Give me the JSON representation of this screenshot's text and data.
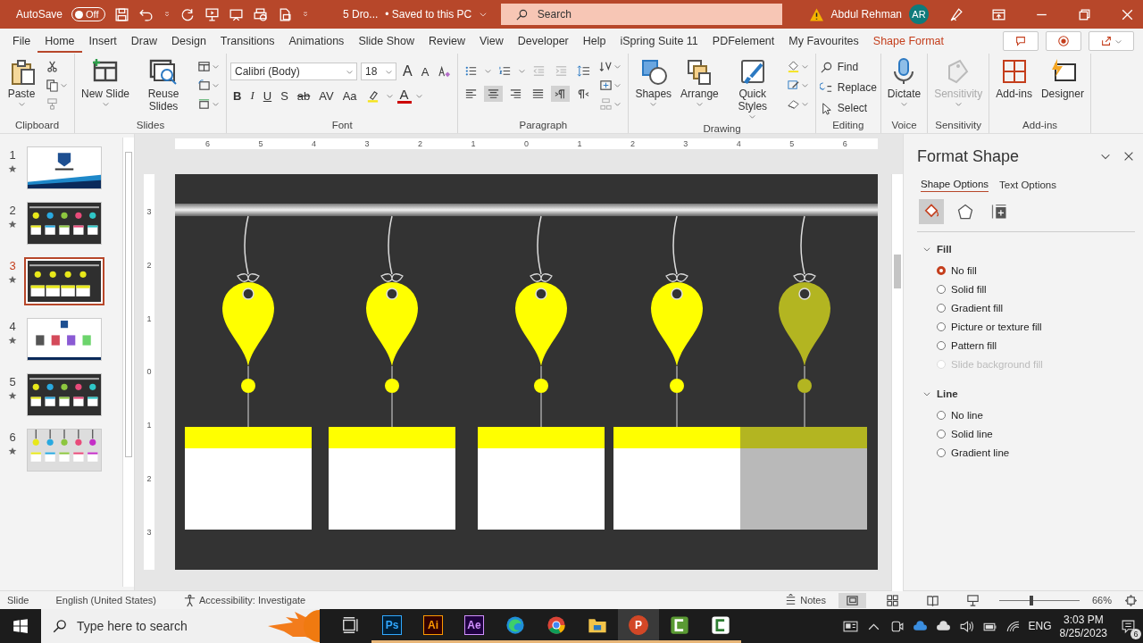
{
  "title_bar": {
    "autosave_label": "AutoSave",
    "autosave_toggle": {
      "label": "Off",
      "on": false
    },
    "document_title": "5 Dro...",
    "save_status": "• Saved to this PC",
    "search": {
      "placeholder": "Search"
    },
    "user_name": "Abdul Rehman",
    "avatar_initials": "AR"
  },
  "menu_tabs": [
    {
      "label": "File",
      "selected": false,
      "kind": "normal"
    },
    {
      "label": "Home",
      "selected": true,
      "kind": "normal"
    },
    {
      "label": "Insert",
      "selected": false,
      "kind": "normal"
    },
    {
      "label": "Draw",
      "selected": false,
      "kind": "normal"
    },
    {
      "label": "Design",
      "selected": false,
      "kind": "normal"
    },
    {
      "label": "Transitions",
      "selected": false,
      "kind": "normal"
    },
    {
      "label": "Animations",
      "selected": false,
      "kind": "normal"
    },
    {
      "label": "Slide Show",
      "selected": false,
      "kind": "normal"
    },
    {
      "label": "Review",
      "selected": false,
      "kind": "normal"
    },
    {
      "label": "View",
      "selected": false,
      "kind": "normal"
    },
    {
      "label": "Developer",
      "selected": false,
      "kind": "normal"
    },
    {
      "label": "Help",
      "selected": false,
      "kind": "normal"
    },
    {
      "label": "iSpring Suite 11",
      "selected": false,
      "kind": "normal"
    },
    {
      "label": "PDFelement",
      "selected": false,
      "kind": "normal"
    },
    {
      "label": "My Favourites",
      "selected": false,
      "kind": "normal"
    },
    {
      "label": "Shape Format",
      "selected": false,
      "kind": "contextual"
    }
  ],
  "ribbon": {
    "groups": [
      {
        "label": "Clipboard",
        "kind": "clipboard",
        "large": [
          {
            "label": "Paste",
            "disabled": false
          }
        ]
      },
      {
        "label": "Slides",
        "kind": "slides",
        "large": [
          {
            "label": "New Slide",
            "disabled": false
          },
          {
            "label": "Reuse Slides",
            "disabled": false
          }
        ]
      },
      {
        "label": "Font",
        "kind": "font",
        "font_name": "Calibri (Body)",
        "font_size": "18",
        "row1": [
          "A",
          "A"
        ],
        "row2": [
          "B",
          "I",
          "U",
          "S",
          "ab",
          "AV",
          "Aa"
        ],
        "font_color_label": "A"
      },
      {
        "label": "Paragraph",
        "kind": "paragraph",
        "row1": [
          {
            "kind": "bullets",
            "selected": false
          },
          {
            "kind": "numbering",
            "selected": false
          },
          {
            "kind": "outdent",
            "selected": false
          },
          {
            "kind": "indent",
            "selected": false
          },
          {
            "kind": "line-spacing",
            "selected": false
          }
        ],
        "row2": [
          {
            "kind": "align-left",
            "selected": false
          },
          {
            "kind": "align-center",
            "selected": true
          },
          {
            "kind": "align-right",
            "selected": false
          },
          {
            "kind": "justify",
            "selected": false
          },
          {
            "kind": "ltr",
            "selected": true
          },
          {
            "kind": "rtl",
            "selected": false
          }
        ]
      },
      {
        "label": "Drawing",
        "kind": "drawing",
        "large": [
          {
            "label": "Shapes",
            "disabled": false
          },
          {
            "label": "Arrange",
            "disabled": false
          },
          {
            "label": "Quick Styles",
            "disabled": false
          }
        ]
      },
      {
        "label": "Editing",
        "kind": "editing",
        "small_buttons": [
          "Find",
          "Replace",
          "Select"
        ]
      },
      {
        "label": "Voice",
        "kind": "voice",
        "large": [
          {
            "label": "Dictate",
            "disabled": false
          }
        ]
      },
      {
        "label": "Sensitivity",
        "kind": "sensitivity",
        "large": [
          {
            "label": "Sensitivity",
            "disabled": true
          }
        ]
      },
      {
        "label": "Add-ins",
        "kind": "addins",
        "large": [
          {
            "label": "Add-ins",
            "disabled": false
          },
          {
            "label": "Designer",
            "disabled": false
          }
        ]
      }
    ]
  },
  "thumbnails": [
    {
      "number": "1",
      "kind": "title",
      "selected": false
    },
    {
      "number": "2",
      "kind": "tags-dark",
      "selected": false
    },
    {
      "number": "3",
      "kind": "tags-yellow",
      "selected": true
    },
    {
      "number": "4",
      "kind": "infographic",
      "selected": false
    },
    {
      "number": "5",
      "kind": "tags-dark",
      "selected": false
    },
    {
      "number": "6",
      "kind": "tags-light",
      "selected": false
    }
  ],
  "rulers": {
    "horizontal": [
      "6",
      "5",
      "4",
      "3",
      "2",
      "1",
      "0",
      "1",
      "2",
      "3",
      "4",
      "5",
      "6"
    ],
    "vertical": [
      "3",
      "2",
      "1",
      "0",
      "1",
      "2",
      "3"
    ]
  },
  "slide": {
    "tags": [
      {
        "selected": false
      },
      {
        "selected": false
      },
      {
        "selected": false
      },
      {
        "selected": false
      },
      {
        "selected": true
      }
    ]
  },
  "format_pane": {
    "title": "Format Shape",
    "tabs": [
      {
        "label": "Shape Options",
        "selected": true
      },
      {
        "label": "Text Options",
        "selected": false
      }
    ],
    "icon_tabs": [
      {
        "kind": "bucket",
        "selected": true
      },
      {
        "kind": "pentagon",
        "selected": false
      },
      {
        "kind": "size",
        "selected": false
      }
    ],
    "sections": [
      {
        "title": "Fill",
        "expanded": true,
        "options": [
          {
            "label": "No fill",
            "selected": true,
            "disabled": false
          },
          {
            "label": "Solid fill",
            "selected": false,
            "disabled": false
          },
          {
            "label": "Gradient fill",
            "selected": false,
            "disabled": false
          },
          {
            "label": "Picture or texture fill",
            "selected": false,
            "disabled": false
          },
          {
            "label": "Pattern fill",
            "selected": false,
            "disabled": false
          },
          {
            "label": "Slide background fill",
            "selected": false,
            "disabled": true
          }
        ]
      },
      {
        "title": "Line",
        "expanded": true,
        "options": [
          {
            "label": "No line",
            "selected": false,
            "disabled": false
          },
          {
            "label": "Solid line",
            "selected": false,
            "disabled": false
          },
          {
            "label": "Gradient line",
            "selected": false,
            "disabled": false
          }
        ]
      }
    ]
  },
  "status_bar": {
    "slide_info": "Slide",
    "language": "English (United States)",
    "accessibility": "Accessibility: Investigate",
    "notes": "Notes",
    "views": [
      {
        "kind": "normal",
        "selected": true
      },
      {
        "kind": "sorter",
        "selected": false
      },
      {
        "kind": "reading",
        "selected": false
      },
      {
        "kind": "presenter",
        "selected": false
      }
    ],
    "zoom": {
      "level": 0.4,
      "reading": "66%"
    }
  },
  "taskbar": {
    "search": {
      "placeholder": "Type here to search"
    },
    "apps": [
      {
        "kind": "task-view",
        "selected": false
      },
      {
        "kind": "ps",
        "label": "Ps",
        "selected": false
      },
      {
        "kind": "ai",
        "label": "Ai",
        "selected": false
      },
      {
        "kind": "ae",
        "label": "Ae",
        "selected": false
      },
      {
        "kind": "edge",
        "selected": false
      },
      {
        "kind": "chrome",
        "selected": false
      },
      {
        "kind": "folder",
        "selected": false
      },
      {
        "kind": "powerpoint",
        "label": "P",
        "selected": true
      },
      {
        "kind": "camtasia-green",
        "selected": false
      },
      {
        "kind": "camtasia-white",
        "selected": false
      }
    ],
    "language": "ENG",
    "time": "3:03 PM",
    "date": "8/25/2023",
    "notification_count": "6"
  }
}
